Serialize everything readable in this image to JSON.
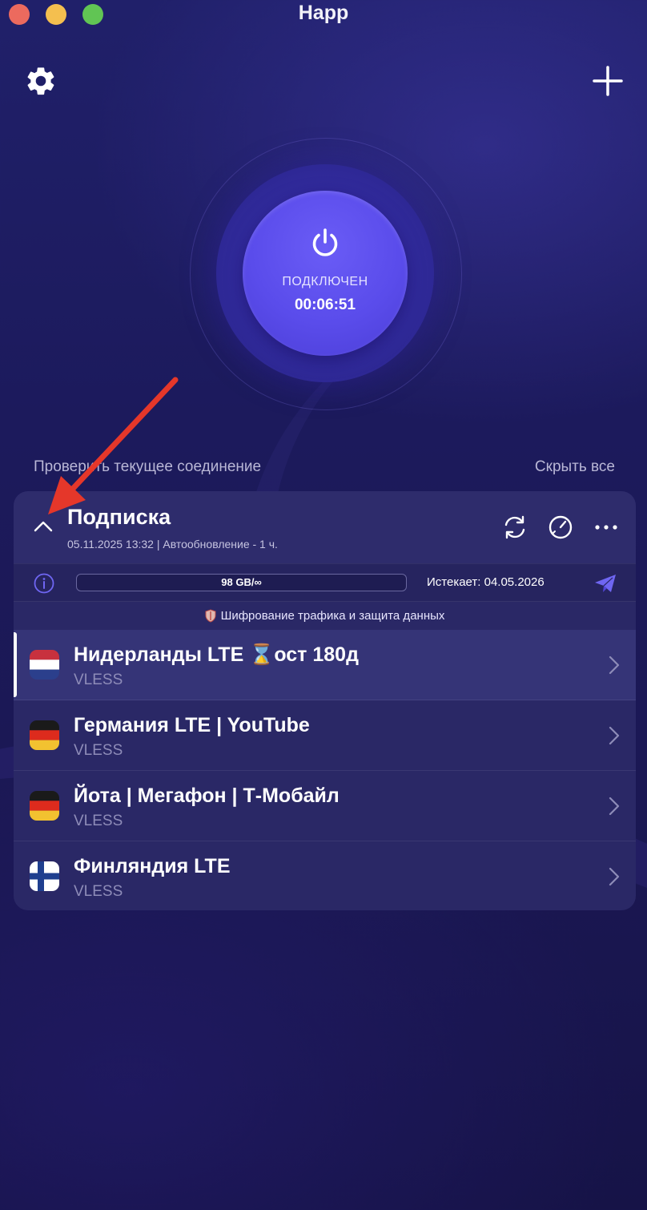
{
  "window": {
    "title": "Happ"
  },
  "toolbar": {
    "settings_icon": "gear-icon",
    "add_icon": "plus-icon"
  },
  "connection": {
    "status": "ПОДКЛЮЧЕН",
    "timer": "00:06:51",
    "check_link": "Проверить текущее соединение",
    "hide_all": "Скрыть все"
  },
  "subscription": {
    "title": "Подписка",
    "meta": "05.11.2025 13:32 | Автообновление - 1 ч.",
    "traffic": "98 GB/∞",
    "expires": "Истекает: 04.05.2026",
    "protection": "Шифрование трафика и защита данных"
  },
  "servers": [
    {
      "name": "Нидерланды LTE ⌛ост 180д",
      "protocol": "VLESS",
      "flag": "nl",
      "selected": true
    },
    {
      "name": "Германия LTE | YouTube",
      "protocol": "VLESS",
      "flag": "de",
      "selected": false
    },
    {
      "name": "Йота | Мегафон | Т-Мобайл",
      "protocol": "VLESS",
      "flag": "de",
      "selected": false
    },
    {
      "name": "Финляндия LTE",
      "protocol": "VLESS",
      "flag": "fi",
      "selected": false
    }
  ],
  "colors": {
    "accent": "#5a4ceb",
    "background": "#1c1a5c",
    "annotation_arrow": "#e5372a"
  }
}
